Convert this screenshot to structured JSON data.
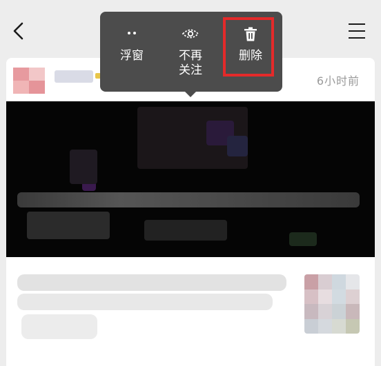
{
  "popup_menu": {
    "items": [
      {
        "label": "浮窗",
        "icon": "floating-window-icon"
      },
      {
        "label_line1": "不再",
        "label_line2": "关注",
        "icon": "eye-icon"
      },
      {
        "label": "删除",
        "icon": "trash-icon"
      }
    ]
  },
  "post": {
    "timestamp": "6小时前"
  },
  "colors": {
    "popup_bg": "#4c4c4c",
    "highlight": "#e42a2a",
    "page_bg": "#ededed"
  }
}
